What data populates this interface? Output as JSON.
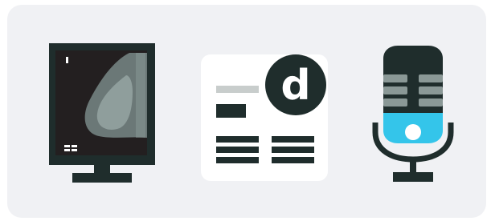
{
  "icons": [
    {
      "name": "mammography-monitor-icon",
      "label": ""
    },
    {
      "name": "radiology-report-icon",
      "label": "",
      "logo_letter": "d"
    },
    {
      "name": "microphone-icon",
      "label": ""
    }
  ],
  "colors": {
    "background": "#f0f1f4",
    "dark": "#1f2d2c",
    "screen": "#231f20",
    "image_gray": "#6b7877",
    "image_light": "#8f9e9c",
    "report_gray": "#c8cdcc",
    "mic_blue": "#34c5ea",
    "grille": "#8a9896"
  }
}
